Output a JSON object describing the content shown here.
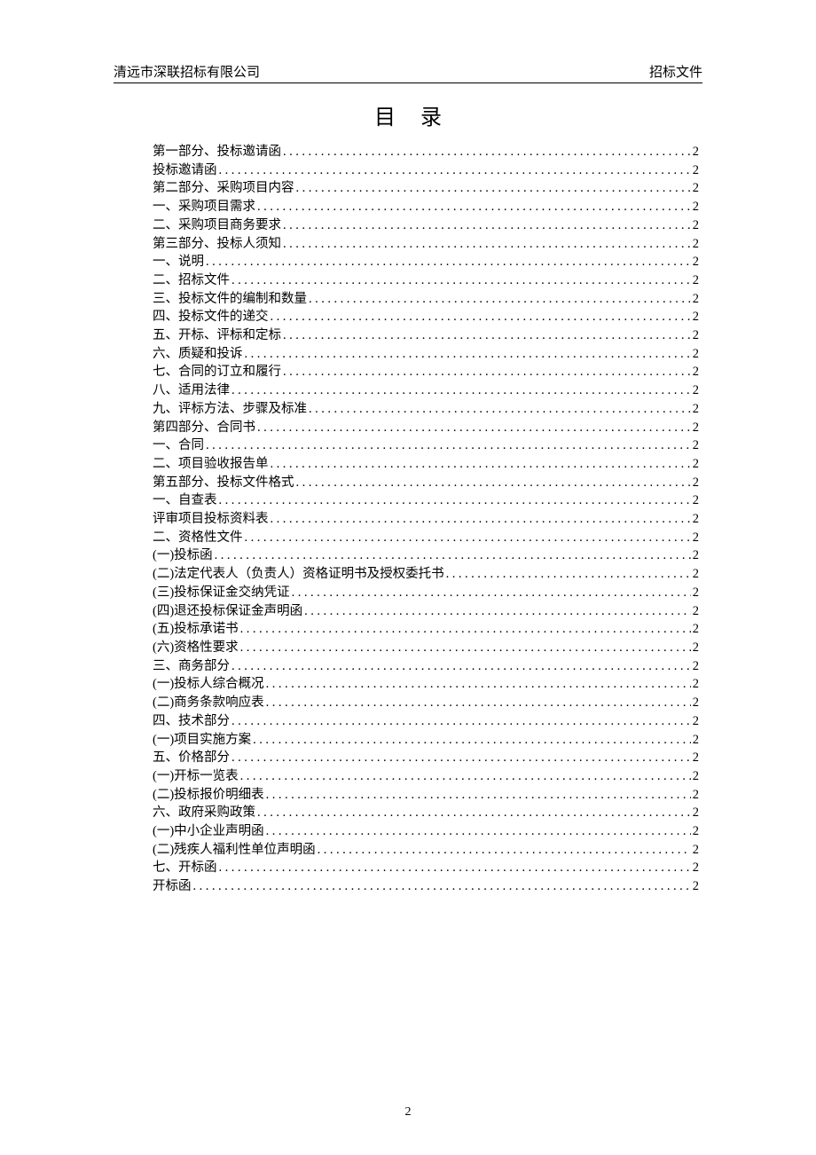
{
  "header": {
    "left": "清远市深联招标有限公司",
    "right": "招标文件"
  },
  "title": "目录",
  "toc": [
    {
      "label": "第一部分、投标邀请函",
      "page": "2"
    },
    {
      "label": "投标邀请函",
      "page": "2"
    },
    {
      "label": "第二部分、采购项目内容",
      "page": "2"
    },
    {
      "label": "一、采购项目需求",
      "page": "2"
    },
    {
      "label": "二、采购项目商务要求",
      "page": "2"
    },
    {
      "label": "第三部分、投标人须知",
      "page": "2"
    },
    {
      "label": "一、说明",
      "page": "2"
    },
    {
      "label": "二、招标文件",
      "page": "2"
    },
    {
      "label": "三、投标文件的编制和数量",
      "page": "2"
    },
    {
      "label": "四、投标文件的递交",
      "page": "2"
    },
    {
      "label": "五、开标、评标和定标",
      "page": "2"
    },
    {
      "label": "六、质疑和投诉",
      "page": "2"
    },
    {
      "label": "七、合同的订立和履行",
      "page": "2"
    },
    {
      "label": "八、适用法律",
      "page": "2"
    },
    {
      "label": "九、评标方法、步骤及标准",
      "page": "2"
    },
    {
      "label": "第四部分、合同书",
      "page": "2"
    },
    {
      "label": "一、合同",
      "page": "2"
    },
    {
      "label": "二、项目验收报告单",
      "page": "2"
    },
    {
      "label": "第五部分、投标文件格式",
      "page": "2"
    },
    {
      "label": "一、自查表",
      "page": "2"
    },
    {
      "label": "评审项目投标资料表",
      "page": "2"
    },
    {
      "label": "二、资格性文件",
      "page": "2"
    },
    {
      "label": "(一)投标函",
      "page": "2"
    },
    {
      "label": "(二)法定代表人（负责人）资格证明书及授权委托书",
      "page": "2"
    },
    {
      "label": "(三)投标保证金交纳凭证",
      "page": "2"
    },
    {
      "label": "(四)退还投标保证金声明函",
      "page": "2"
    },
    {
      "label": "(五)投标承诺书",
      "page": "2"
    },
    {
      "label": "(六)资格性要求",
      "page": "2"
    },
    {
      "label": "三、商务部分",
      "page": "2"
    },
    {
      "label": "(一)投标人综合概况",
      "page": "2"
    },
    {
      "label": "(二)商务条款响应表",
      "page": "2"
    },
    {
      "label": "四、技术部分",
      "page": "2"
    },
    {
      "label": "(一)项目实施方案",
      "page": "2"
    },
    {
      "label": "五、价格部分",
      "page": "2"
    },
    {
      "label": "(一)开标一览表",
      "page": "2"
    },
    {
      "label": "(二)投标报价明细表",
      "page": "2"
    },
    {
      "label": "六、政府采购政策",
      "page": "2"
    },
    {
      "label": "(一)中小企业声明函",
      "page": "2"
    },
    {
      "label": "(二)残疾人福利性单位声明函",
      "page": "2"
    },
    {
      "label": "七、开标函",
      "page": "2"
    },
    {
      "label": "开标函",
      "page": "2"
    }
  ],
  "page_number": "2"
}
